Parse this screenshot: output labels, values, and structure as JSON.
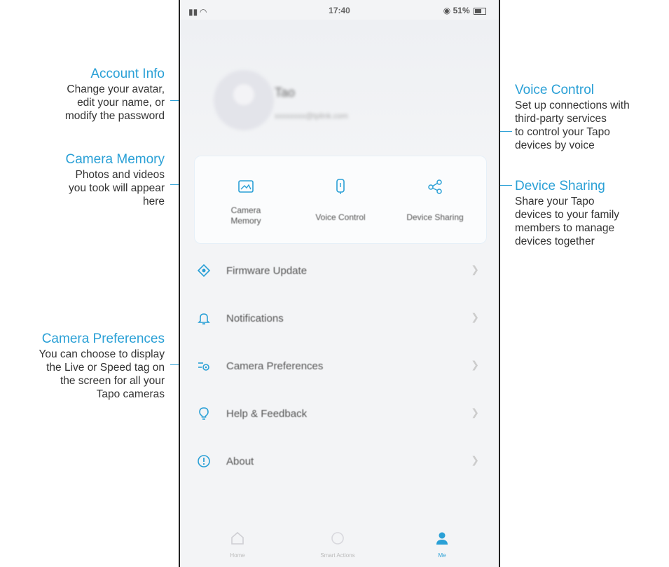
{
  "phone": {
    "status": {
      "time": "17:40",
      "battery_text": "51%"
    },
    "profile": {
      "name": "Tao",
      "email": "xxxxxxxx@tplink.com"
    },
    "quick_actions": [
      {
        "label_line1": "Camera",
        "label_line2": "Memory",
        "icon": "camera-memory-icon"
      },
      {
        "label_line1": "Voice Control",
        "label_line2": "",
        "icon": "voice-control-icon"
      },
      {
        "label_line1": "Device Sharing",
        "label_line2": "",
        "icon": "device-sharing-icon"
      }
    ],
    "menu": [
      {
        "label": "Firmware Update",
        "icon": "firmware-update-icon"
      },
      {
        "label": "Notifications",
        "icon": "bell-icon"
      },
      {
        "label": "Camera Preferences",
        "icon": "preferences-icon"
      },
      {
        "label": "Help & Feedback",
        "icon": "lightbulb-icon"
      },
      {
        "label": "About",
        "icon": "info-icon"
      }
    ],
    "tabs": [
      {
        "label": "Home",
        "icon": "home-icon"
      },
      {
        "label": "Smart Actions",
        "icon": "smart-actions-icon"
      },
      {
        "label": "Me",
        "icon": "me-icon"
      }
    ],
    "accent_color": "#2aa0d6"
  },
  "callouts": {
    "account_info": {
      "title": "Account Info",
      "lines": [
        "Change your avatar,",
        "edit your name, or",
        "modify the password"
      ]
    },
    "camera_memory": {
      "title": "Camera Memory",
      "lines": [
        "Photos and videos",
        "you took will appear",
        "here"
      ]
    },
    "camera_preferences": {
      "title": "Camera Preferences",
      "lines": [
        "You can choose to display",
        "the Live or Speed tag on",
        "the screen for all your",
        "Tapo cameras"
      ]
    },
    "voice_control": {
      "title": "Voice Control",
      "lines": [
        "Set up connections with",
        "third-party services",
        "to control your Tapo",
        "devices by voice"
      ]
    },
    "device_sharing": {
      "title": "Device Sharing",
      "lines": [
        "Share your Tapo",
        "devices to your family",
        "members to manage",
        "devices together"
      ]
    }
  }
}
